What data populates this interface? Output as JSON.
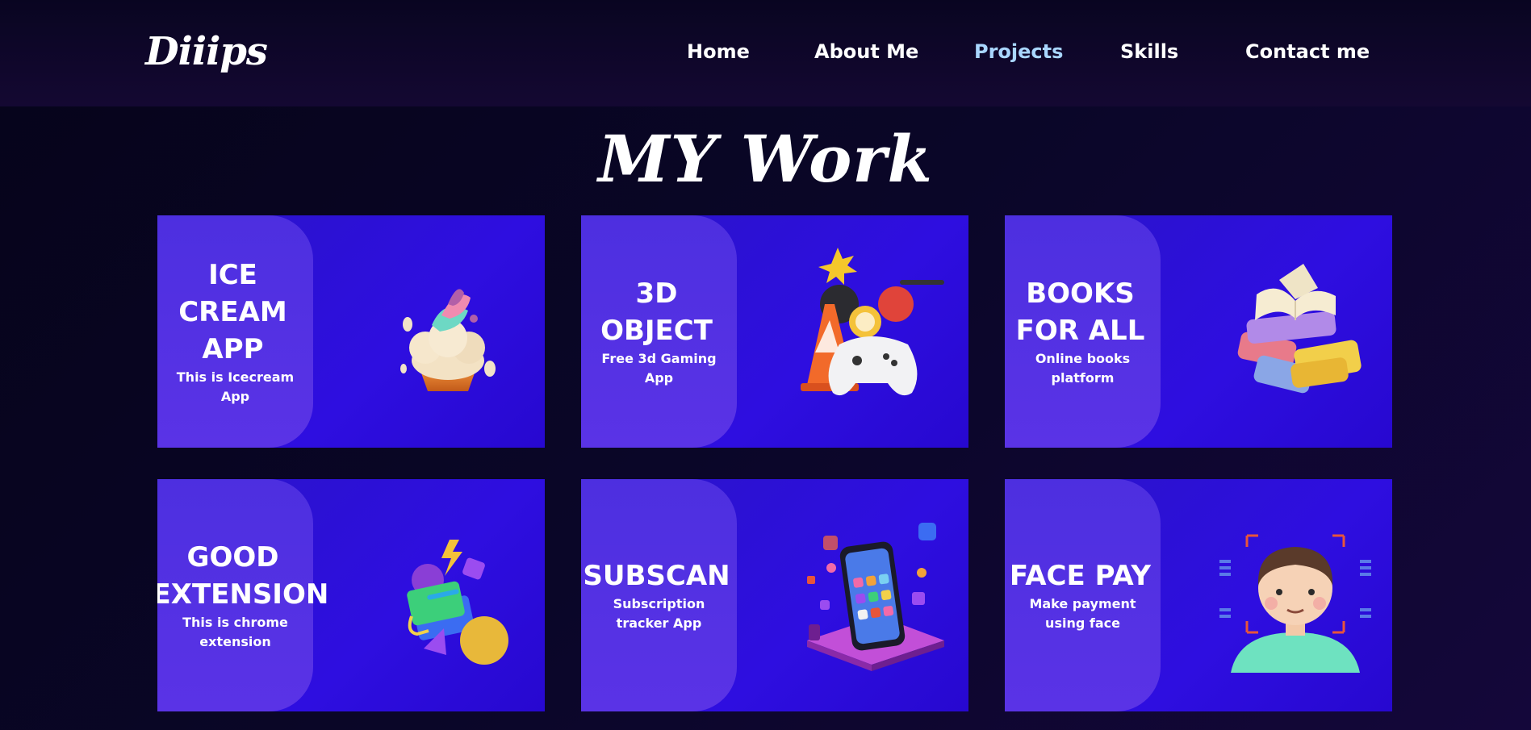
{
  "header": {
    "logo": "Diiips",
    "nav": [
      "Home",
      "About Me",
      "Projects",
      "Skills",
      "Contact me"
    ],
    "active_nav": "Projects"
  },
  "main": {
    "title": "MY Work",
    "projects": [
      {
        "title": "ICE CREAM APP",
        "subtitle": "This is Icecream App",
        "icon": "ice-cream-icon"
      },
      {
        "title": "3D OBJECT",
        "subtitle": "Free 3d Gaming App",
        "icon": "gamepad-icon"
      },
      {
        "title": "BOOKS FOR ALL",
        "subtitle": "Online books platform",
        "icon": "books-icon"
      },
      {
        "title": "GOOD EXTENSION",
        "subtitle": "This is chrome extension",
        "icon": "shapes-icon"
      },
      {
        "title": "SUBSCAN",
        "subtitle": "Subscription tracker App",
        "icon": "phone-apps-icon"
      },
      {
        "title": "FACE PAY",
        "subtitle": "Make payment using face",
        "icon": "face-scan-icon"
      }
    ]
  },
  "colors": {
    "background": "#0a0628",
    "card": "#2e0ee0",
    "card_panel": "#5a33e6",
    "nav_active": "#a9d6ff"
  }
}
